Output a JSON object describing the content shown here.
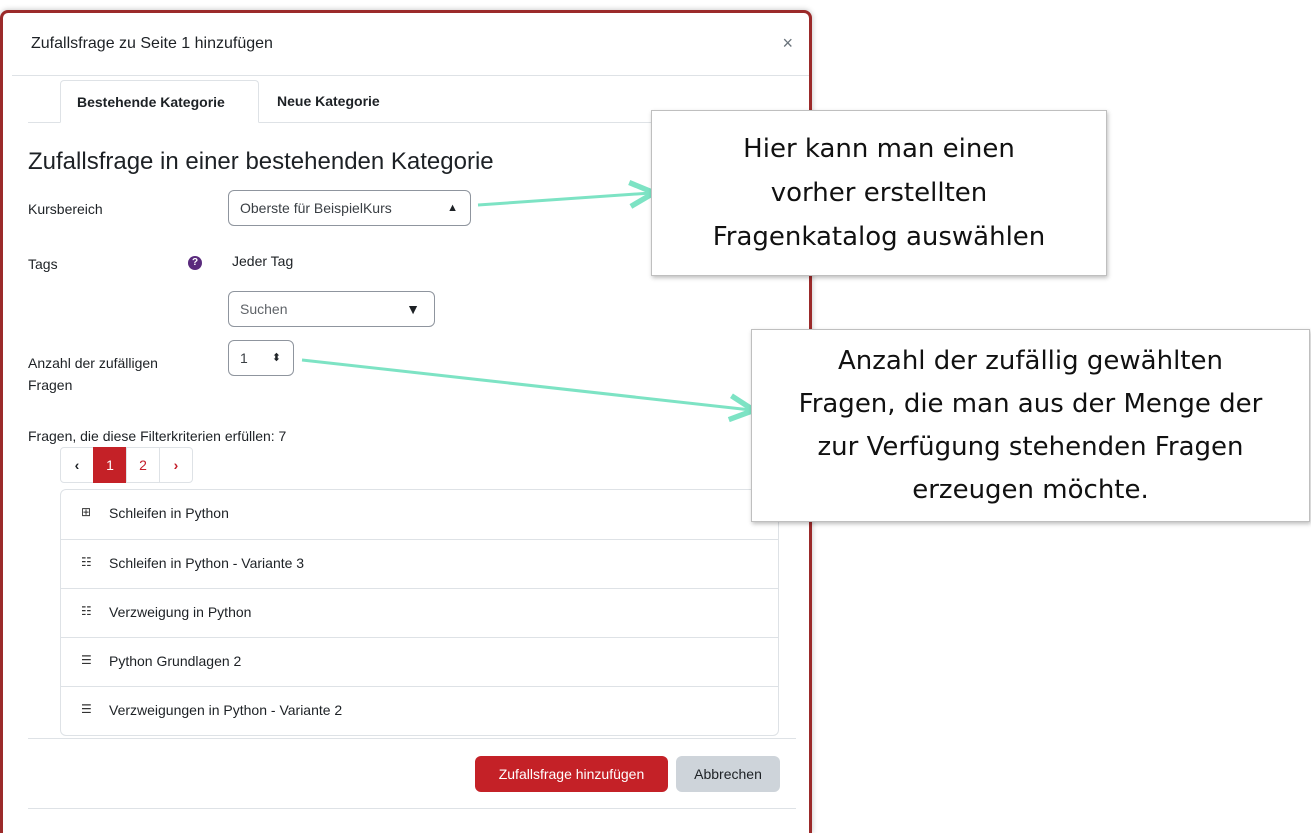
{
  "modal": {
    "title": "Zufallsfrage zu Seite 1 hinzufügen",
    "close_glyph": "×",
    "tabs": [
      {
        "label": "Bestehende Kategorie",
        "active": true
      },
      {
        "label": "Neue Kategorie",
        "active": false
      }
    ],
    "heading": "Zufallsfrage in einer bestehenden Kategorie",
    "fields": {
      "kursbereich_label": "Kursbereich",
      "kursbereich_value": "Oberste für BeispielKurs",
      "tags_label": "Tags",
      "tags_help_glyph": "?",
      "tags_value": "Jeder Tag",
      "tags_search_placeholder": "Suchen",
      "anzahl_label_line1": "Anzahl der zufälligen",
      "anzahl_label_line2": "Fragen",
      "anzahl_value": "1"
    },
    "filter_summary": "Fragen, die diese Filterkriterien erfüllen: 7",
    "pagination": {
      "prev": "‹",
      "pages": [
        "1",
        "2"
      ],
      "current": "1",
      "next": "›"
    },
    "questions": [
      {
        "icon": "drag-drop-icon",
        "label": "Schleifen in Python"
      },
      {
        "icon": "ordering-icon",
        "label": "Schleifen in Python - Variante 3"
      },
      {
        "icon": "ordering-icon",
        "label": "Verzweigung in Python"
      },
      {
        "icon": "list-icon",
        "label": "Python Grundlagen 2"
      },
      {
        "icon": "list-icon",
        "label": "Verzweigungen in Python - Variante 2"
      }
    ],
    "buttons": {
      "submit": "Zufallsfrage hinzufügen",
      "cancel": "Abbrechen"
    }
  },
  "callouts": {
    "kategorie": [
      "Hier kann man einen",
      "vorher erstellten",
      "Fragenkatalog auswählen"
    ],
    "anzahl": [
      "Anzahl der zufällig gewählten",
      "Fragen, die man aus der Menge der",
      "zur Verfügung stehenden Fragen",
      "erzeugen möchte."
    ]
  },
  "colors": {
    "brand_red": "#c42127",
    "modal_border": "#9b2a2a",
    "arrow": "#7de3c4"
  }
}
